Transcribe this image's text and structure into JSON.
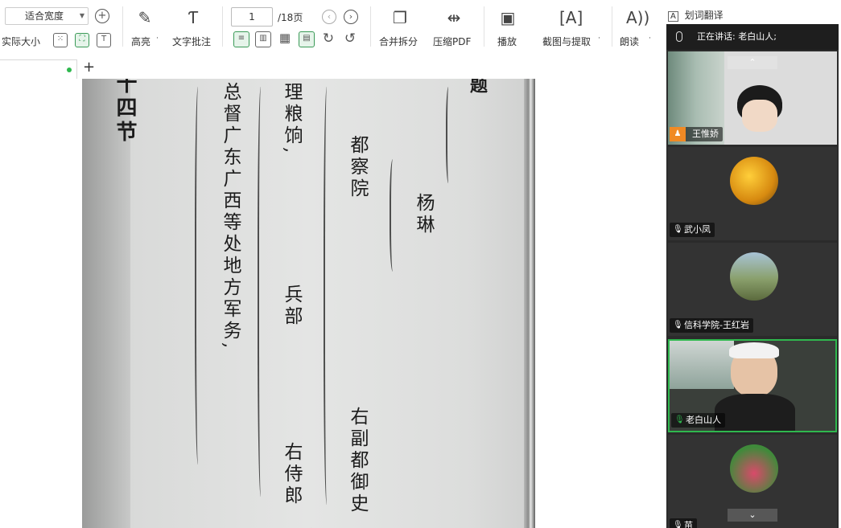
{
  "toolbar": {
    "zoom_mode": "适合宽度",
    "actual_size": "实际大小",
    "highlight": "高亮",
    "text_comment": "文字批注",
    "page_current": "1",
    "page_total": "/18页",
    "merge_split": "合并拆分",
    "compress_pdf": "压缩PDF",
    "play": "播放",
    "screenshot_extract": "截图与提取",
    "read_aloud": "朗读",
    "translate": "划词翻译",
    "dropdown_mark": "·"
  },
  "document": {
    "col_section": "四节",
    "col_title_prefix": "题",
    "col_person": "杨琳",
    "col_office": "都察院",
    "col_office_title": "右副都御史",
    "col_ministry": "兵部",
    "col_ministry_title": "右侍郎",
    "col_grain": "理粮饷,",
    "col_governor": "总督广东广西等处地方军务,",
    "col_partial_left": "十"
  },
  "meeting": {
    "speaking_label": "正在讲话: 老白山人;",
    "participants": [
      {
        "name": "王惟娇",
        "avatar": "camera"
      },
      {
        "name": "武小凤",
        "avatar": "photo-autumn"
      },
      {
        "name": "信科学院-王红岩",
        "avatar": "photo-couple"
      },
      {
        "name": "老白山人",
        "avatar": "camera"
      },
      {
        "name": "苗",
        "avatar": "photo-flowers"
      }
    ]
  },
  "colors": {
    "accent_green": "#2fb84e",
    "panel_bg": "#2b2b2b"
  }
}
